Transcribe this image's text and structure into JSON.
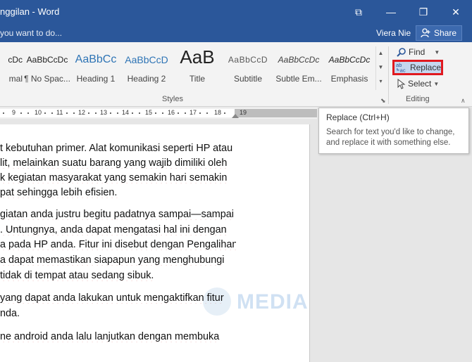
{
  "window": {
    "title": "nggilan - Word",
    "restore_icon_glyph": "⧉",
    "minimize_glyph": "—",
    "maximize_glyph": "❐",
    "close_glyph": "✕"
  },
  "tellme": {
    "text": "you want to do...",
    "user": "Viera Nie",
    "share": "Share"
  },
  "styles": {
    "items": [
      {
        "sample": "cDc",
        "label": "mal",
        "color": "#222222"
      },
      {
        "sample": "AaBbCcDc",
        "label": "¶ No Spac...",
        "color": "#222222"
      },
      {
        "sample": "AaBbCc",
        "label": "Heading 1",
        "color": "#2e74b5"
      },
      {
        "sample": "AaBbCcD",
        "label": "Heading 2",
        "color": "#2e74b5"
      },
      {
        "sample": "AaB",
        "label": "Title",
        "color": "#222222"
      },
      {
        "sample": "AaBbCcD",
        "label": "Subtitle",
        "color": "#595959"
      },
      {
        "sample": "AaBbCcDc",
        "label": "Subtle Em...",
        "color": "#404040"
      },
      {
        "sample": "AaBbCcDc",
        "label": "Emphasis",
        "color": "#222222"
      }
    ],
    "group_label": "Styles"
  },
  "editing": {
    "find": "Find",
    "replace": "Replace",
    "select": "Select",
    "group_label": "Editing"
  },
  "ruler": {
    "ticks": [
      "9",
      "10",
      "11",
      "12",
      "13",
      "14",
      "15",
      "16",
      "17",
      "18",
      "19"
    ]
  },
  "tooltip": {
    "title": "Replace (Ctrl+H)",
    "body": "Search for text you'd like to change, and replace it with something else."
  },
  "document": {
    "lines": [
      "t kebutuhan primer. Alat komunikasi seperti HP atau",
      "lit, melainkan suatu barang yang wajib dimiliki oleh",
      "k  kegiatan  masyarakat  yang  semakin  hari  semakin",
      "pat sehingga lebih efisien.",
      "giatan anda justru begitu padatnya sampai—sampai",
      ". Untungnya, anda dapat mengatasi hal ini dengan",
      "a pada HP anda. Fitur ini disebut dengan Pengalihan",
      "a  dapat  memastikan  siapapun  yang  menghubungi",
      " tidak di tempat atau sedang sibuk.",
      " yang dapat anda lakukan untuk mengaktifkan fitur",
      "nda.",
      "ne  android  anda  lalu  lanjutkan  dengan  membuka"
    ],
    "watermark": "MEDIA"
  }
}
